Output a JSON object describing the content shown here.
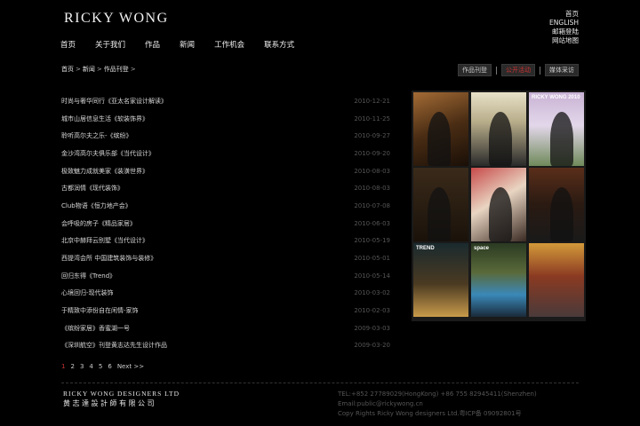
{
  "brand": {
    "logo": "RICKY WONG"
  },
  "top_links": [
    "首页",
    "ENGLISH",
    "邮箱登陆",
    "网站地图"
  ],
  "nav": [
    "首页",
    "关于我们",
    "作品",
    "新闻",
    "工作机会",
    "联系方式"
  ],
  "breadcrumb": {
    "home": "首页",
    "news": "新闻",
    "current": "作品刊登",
    "trail": ">"
  },
  "tabs": [
    "作品刊登",
    "公开活动",
    "媒体采访"
  ],
  "active_tab": 1,
  "articles": [
    {
      "title": "时尚与奢华同行《亚太名家设计解读》",
      "date": "2010-12-21"
    },
    {
      "title": "城市山居信息生活《软装饰界》",
      "date": "2010-11-25"
    },
    {
      "title": "聆听高尔夫之乐-《缤纷》",
      "date": "2010-09-27"
    },
    {
      "title": "金沙湾高尔夫俱乐部《当代设计》",
      "date": "2010-09-20"
    },
    {
      "title": "极致魅力成就美家《装潢世界》",
      "date": "2010-08-03"
    },
    {
      "title": "古都润情《现代装饰》",
      "date": "2010-08-03"
    },
    {
      "title": "Club物语《恒力地产会》",
      "date": "2010-07-08"
    },
    {
      "title": "会呼吸的房子《精品家居》",
      "date": "2010-06-03"
    },
    {
      "title": "北京中赫拜云别墅《当代设计》",
      "date": "2010-05-19"
    },
    {
      "title": "西提湾会所 中国建筑装饰与装修》",
      "date": "2010-05-01"
    },
    {
      "title": "回归东得《Trend》",
      "date": "2010-05-14"
    },
    {
      "title": "心境回归-现代装饰",
      "date": "2010-03-02"
    },
    {
      "title": "于精致中添份自在闲情-家饰",
      "date": "2010-02-03"
    },
    {
      "title": "《缤纷家居》香蜜湖一号",
      "date": "2009-03-03"
    },
    {
      "title": "《深圳航空》刊登黄志达先生设计作品",
      "date": "2009-03-20"
    }
  ],
  "pagination": {
    "pages": [
      "1",
      "2",
      "3",
      "4",
      "5",
      "6"
    ],
    "current": 1,
    "next": "Next >>"
  },
  "gallery": [
    {
      "icon": "event-photo",
      "caption": "",
      "color": "#7a4a22"
    },
    {
      "icon": "event-photo",
      "caption": "",
      "color": "#d8d0b5"
    },
    {
      "icon": "event-photo",
      "caption": "RICKY WONG 2010",
      "color": "#c9b3d4"
    },
    {
      "icon": "event-photo",
      "caption": "",
      "color": "#2a1e12"
    },
    {
      "icon": "event-photo",
      "caption": "",
      "color": "#c74a4a"
    },
    {
      "icon": "event-photo",
      "caption": "",
      "color": "#3a2218"
    },
    {
      "icon": "magazine-cover",
      "caption": "TREND",
      "color": "#1a2a2e"
    },
    {
      "icon": "magazine-cover",
      "caption": "space",
      "color": "#3a88b8"
    },
    {
      "icon": "magazine-cover",
      "caption": "",
      "color": "#d49a3a"
    }
  ],
  "footer": {
    "logo_en": "RICKY WONG DESIGNERS LTD",
    "logo_cn": "黄志達設計師有限公司",
    "tel": "TEL:+852 27789029(HongKong)  +86 755 82945411(Shenzhen)",
    "email": "Email:public@rickywong.cn",
    "copyright": "Copy Rights Ricky Wong designers Ltd.粤ICP备 09092801号"
  }
}
